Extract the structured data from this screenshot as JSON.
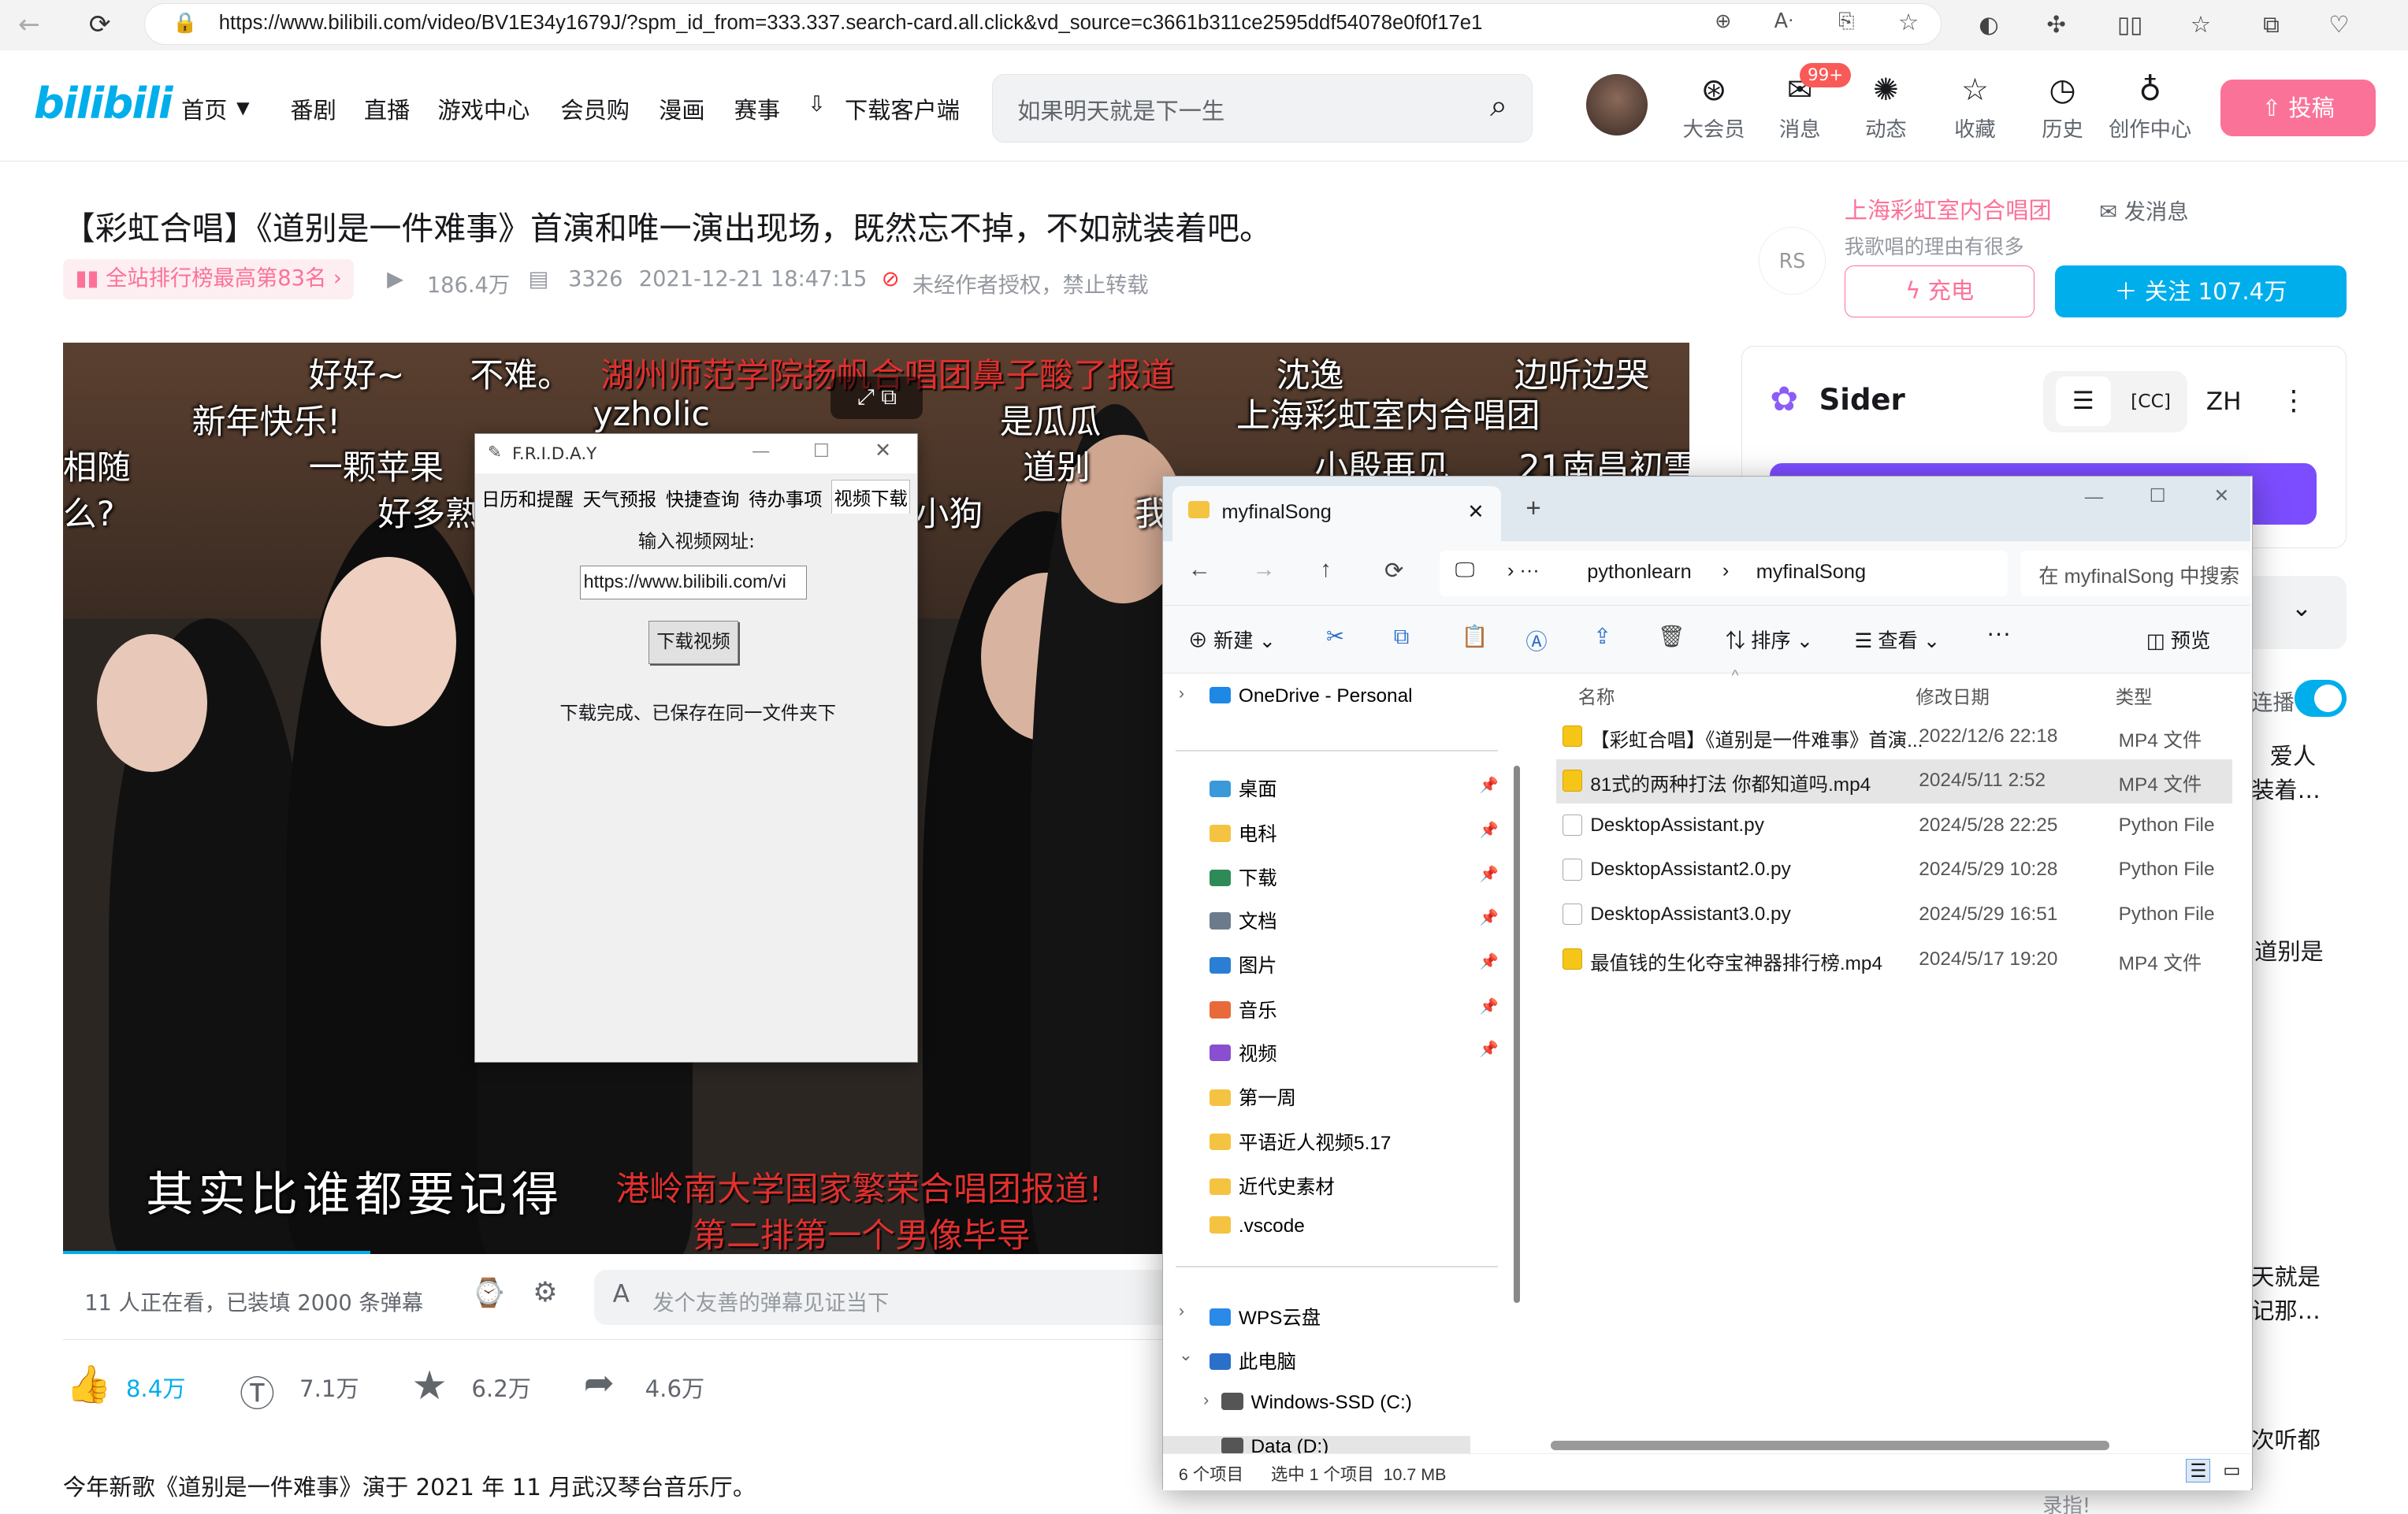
{
  "browser": {
    "url": "https://www.bilibili.com/video/BV1E34y1679J/?spm_id_from=333.337.search-card.all.click&vd_source=c3661b311ce2595ddf54078e0f0f17e1"
  },
  "header": {
    "logo": "bilibili",
    "nav": [
      "首页",
      "番剧",
      "直播",
      "游戏中心",
      "会员购",
      "漫画",
      "赛事",
      "下载客户端"
    ],
    "search_placeholder": "如果明天就是下一生",
    "right_items": [
      "大会员",
      "消息",
      "动态",
      "收藏",
      "历史",
      "创作中心"
    ],
    "msg_badge": "99+",
    "upload": "投稿"
  },
  "video": {
    "title": "【彩虹合唱】《道别是一件难事》首演和唯一演出现场，既然忘不掉，不如就装着吧。",
    "rank": "全站排行榜最高第83名",
    "views": "186.4万",
    "danmaku_count": "3326",
    "date": "2021-12-21 18:47:15",
    "copyright": "未经作者授权，禁止转载",
    "danmaku": [
      "好好~",
      "不难。",
      "湖州师范学院扬帆合唱团鼻子酸了报道",
      "沈逸",
      "边听边哭",
      "新年快乐!",
      "yzholic",
      "是瓜瓜",
      "上海彩虹室内合唱团",
      "一颗苹果",
      "道别",
      "小殷再见",
      "21南昌初雪",
      "好多熟",
      "小狗",
      "我",
      "相随",
      "么?"
    ],
    "subtitle": "其实比谁都要记得",
    "red_dm1": "港岭南大学国家繁荣合唱团报道!",
    "red_dm2": "第二排第一个男像毕导",
    "watching": "11 人正在看，已装填 2000 条弹幕",
    "dm_placeholder": "发个友善的弹幕见证当下",
    "likes": "8.4万",
    "coins": "7.1万",
    "favs": "6.2万",
    "shares": "4.6万",
    "desc": "今年新歌《道别是一件难事》演于 2021 年 11 月武汉琴台音乐厅。"
  },
  "uploader": {
    "name": "上海彩虹室内合唱团",
    "msg": "发消息",
    "sign": "我歌唱的理由有很多",
    "charge": "充电",
    "follow": "关注 107.4万"
  },
  "sider": {
    "name": "Sider",
    "lang": "ZH",
    "autoplay": "连播",
    "rec1": "爱人",
    "rec1b": "装着…",
    "rec2": "道别是",
    "rec3": "天就是",
    "rec3b": "记那…",
    "rec4": "次听都",
    "rec5": "录指!"
  },
  "friday": {
    "title": "F.R.I.D.A.Y",
    "tabs": [
      "日历和提醒",
      "天气预报",
      "快捷查询",
      "待办事项",
      "视频下载"
    ],
    "label": "输入视频网址:",
    "input": "https://www.bilibili.com/vi",
    "button": "下载视频",
    "status": "下载完成、已保存在同一文件夹下"
  },
  "explorer": {
    "tab": "myfinalSong",
    "crumbs": [
      "pythonlearn",
      "myfinalSong"
    ],
    "search": "在 myfinalSong 中搜索",
    "toolbar": {
      "new": "新建",
      "sort": "排序",
      "view": "查看",
      "preview": "预览"
    },
    "tree": [
      {
        "name": "OneDrive - Personal",
        "color": "#1e88e5"
      },
      {
        "name": "桌面",
        "color": "#3a9ad9",
        "pin": true
      },
      {
        "name": "电科",
        "color": "#f5c342",
        "pin": true
      },
      {
        "name": "下载",
        "color": "#2e8b57",
        "pin": true
      },
      {
        "name": "文档",
        "color": "#6b7b8c",
        "pin": true
      },
      {
        "name": "图片",
        "color": "#2a7fd4",
        "pin": true
      },
      {
        "name": "音乐",
        "color": "#e86a3a",
        "pin": true
      },
      {
        "name": "视频",
        "color": "#8a4fd0",
        "pin": true
      },
      {
        "name": "第一周",
        "color": "#f5c342"
      },
      {
        "name": "平语近人视频5.17",
        "color": "#f5c342"
      },
      {
        "name": "近代史素材",
        "color": "#f5c342"
      },
      {
        "name": ".vscode",
        "color": "#f5c342"
      },
      {
        "name": "WPS云盘",
        "color": "#2a8ae8"
      },
      {
        "name": "此电脑",
        "color": "#2a6fc9"
      },
      {
        "name": "Windows-SSD (C:)",
        "color": "#555"
      },
      {
        "name": "Data (D:)",
        "color": "#555"
      }
    ],
    "columns": [
      "名称",
      "修改日期",
      "类型"
    ],
    "files": [
      {
        "name": "【彩虹合唱】《道别是一件难事》首演...",
        "date": "2022/12/6 22:18",
        "type": "MP4 文件",
        "kind": "mp4"
      },
      {
        "name": "81式的两种打法 你都知道吗.mp4",
        "date": "2024/5/11 2:52",
        "type": "MP4 文件",
        "kind": "mp4"
      },
      {
        "name": "DesktopAssistant.py",
        "date": "2024/5/28 22:25",
        "type": "Python File",
        "kind": "py"
      },
      {
        "name": "DesktopAssistant2.0.py",
        "date": "2024/5/29 10:28",
        "type": "Python File",
        "kind": "py"
      },
      {
        "name": "DesktopAssistant3.0.py",
        "date": "2024/5/29 16:51",
        "type": "Python File",
        "kind": "py"
      },
      {
        "name": "最值钱的生化夺宝神器排行榜.mp4",
        "date": "2024/5/17 19:20",
        "type": "MP4 文件",
        "kind": "mp4"
      }
    ],
    "status_count": "6 个项目",
    "status_sel": "选中 1 个项目  10.7 MB"
  }
}
